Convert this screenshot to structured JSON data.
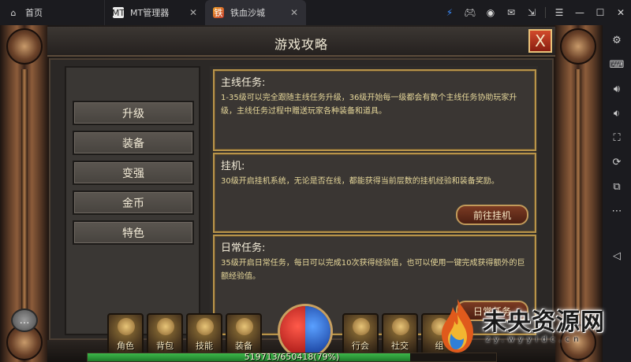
{
  "titlebar": {
    "tabs": [
      {
        "label": "首页",
        "icon": "home-icon"
      },
      {
        "label": "MT管理器",
        "icon": "mt-manager-icon"
      },
      {
        "label": "铁血沙城",
        "icon": "game-icon"
      }
    ]
  },
  "window_controls": [
    "lightning-icon",
    "gamepad-icon",
    "user-icon",
    "mail-icon",
    "collapse-icon",
    "menu-icon",
    "minimize-icon",
    "maximize-icon",
    "close-icon"
  ],
  "sidebar_tools": [
    "settings-icon",
    "keyboard-icon",
    "volume-up-icon",
    "volume-down-icon",
    "screenshot-icon",
    "rotate-icon",
    "multi-instance-icon",
    "more-icon",
    "back-icon"
  ],
  "dialog": {
    "title": "游戏攻略",
    "close_label": "X"
  },
  "categories": [
    "升级",
    "装备",
    "变强",
    "金币",
    "特色"
  ],
  "quests": [
    {
      "title": "主线任务:",
      "desc": "1-35级可以完全跟随主线任务升级，36级开始每一级都会有数个主线任务协助玩家升级，主线任务过程中赠送玩家各种装备和道具。"
    },
    {
      "title": "挂机:",
      "desc": "30级开启挂机系统，无论是否在线，都能获得当前层数的挂机经验和装备奖励。",
      "button": "前往挂机"
    },
    {
      "title": "日常任务:",
      "desc": "35级开启日常任务，每日可以完成10次获得经验值，也可以使用一键完成获得额外的巨额经验值。",
      "button": "日常任务"
    }
  ],
  "skills_left": [
    "角色",
    "背包",
    "技能",
    "装备"
  ],
  "skills_right": [
    "行会",
    "社交",
    "组"
  ],
  "xp": {
    "text": "519713/650418(79%)",
    "fraction": 0.79
  },
  "watermark": {
    "title": "未央资源网",
    "url": "zy.wyyidc.cn"
  },
  "colors": {
    "accent_gold": "#b8944a",
    "hp_red": "#c0392b",
    "mp_blue": "#2c5fd6",
    "xp_green": "#2e9a3a"
  }
}
